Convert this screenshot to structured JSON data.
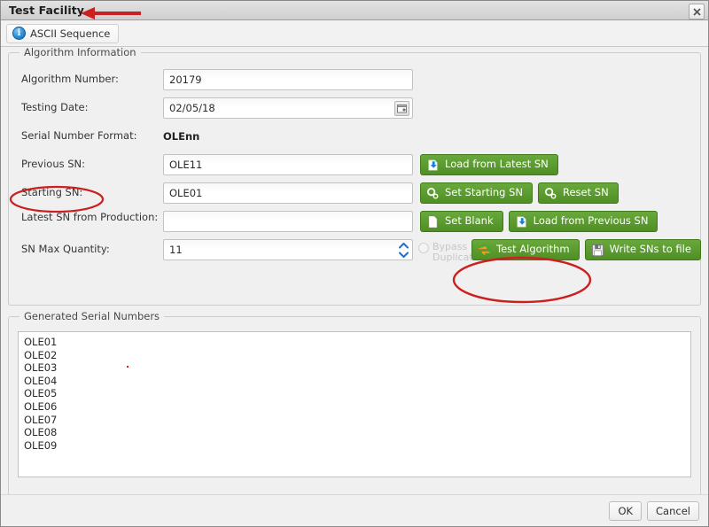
{
  "window": {
    "title": "Test Facility",
    "close_icon": "close-icon"
  },
  "tabs": [
    {
      "label": "ASCII Sequence",
      "icon": "info-icon",
      "selected": true
    }
  ],
  "colors": {
    "button_green": "#4f8f23",
    "annotation_red": "#cc1f1f",
    "window_bg": "#f0f0f0",
    "field_bg": "#ffffff"
  },
  "algorithm_group": {
    "legend": "Algorithm Information",
    "fields": {
      "algorithm_number": {
        "label": "Algorithm Number:",
        "value": "20179"
      },
      "testing_date": {
        "label": "Testing Date:",
        "value": "02/05/18",
        "picker_icon": "calendar-icon"
      },
      "serial_number_format": {
        "label": "Serial Number Format:",
        "value": "OLEnn"
      },
      "previous_sn": {
        "label": "Previous SN:",
        "value": "OLE11"
      },
      "starting_sn": {
        "label": "Starting SN:",
        "value": "OLE01"
      },
      "latest_sn_from_production": {
        "label": "Latest SN from Production:",
        "value": ""
      },
      "sn_max_quantity": {
        "label": "SN Max Quantity:",
        "value": "11"
      }
    },
    "buttons": {
      "load_from_latest_sn": {
        "label": "Load from Latest SN",
        "icon": "import-arrow-icon"
      },
      "set_starting_sn": {
        "label": "Set Starting SN",
        "icon": "gears-icon"
      },
      "reset_sn": {
        "label": "Reset SN",
        "icon": "gears-icon"
      },
      "set_blank": {
        "label": "Set Blank",
        "icon": "blank-page-icon"
      },
      "load_from_previous_sn": {
        "label": "Load from Previous SN",
        "icon": "import-arrow-icon"
      },
      "test_algorithm": {
        "label": "Test Algorithm",
        "icon": "refresh-icon"
      },
      "write_sns_to_file": {
        "label": "Write SNs to file",
        "icon": "save-disk-icon"
      }
    },
    "bypass_duplicate": {
      "label_line1": "Bypass",
      "label_line2": "Duplicate",
      "checked": false,
      "enabled": false
    }
  },
  "generated_group": {
    "legend": "Generated Serial Numbers",
    "serial_numbers": [
      "OLE01",
      "OLE02",
      "OLE03",
      "OLE04",
      "OLE05",
      "OLE06",
      "OLE07",
      "OLE08",
      "OLE09"
    ]
  },
  "footer": {
    "ok_label": "OK",
    "cancel_label": "Cancel"
  },
  "annotations": {
    "title_arrow": "red-left-arrow",
    "starting_sn_ellipse": "red-ellipse",
    "test_algorithm_ellipse": "red-ellipse"
  }
}
